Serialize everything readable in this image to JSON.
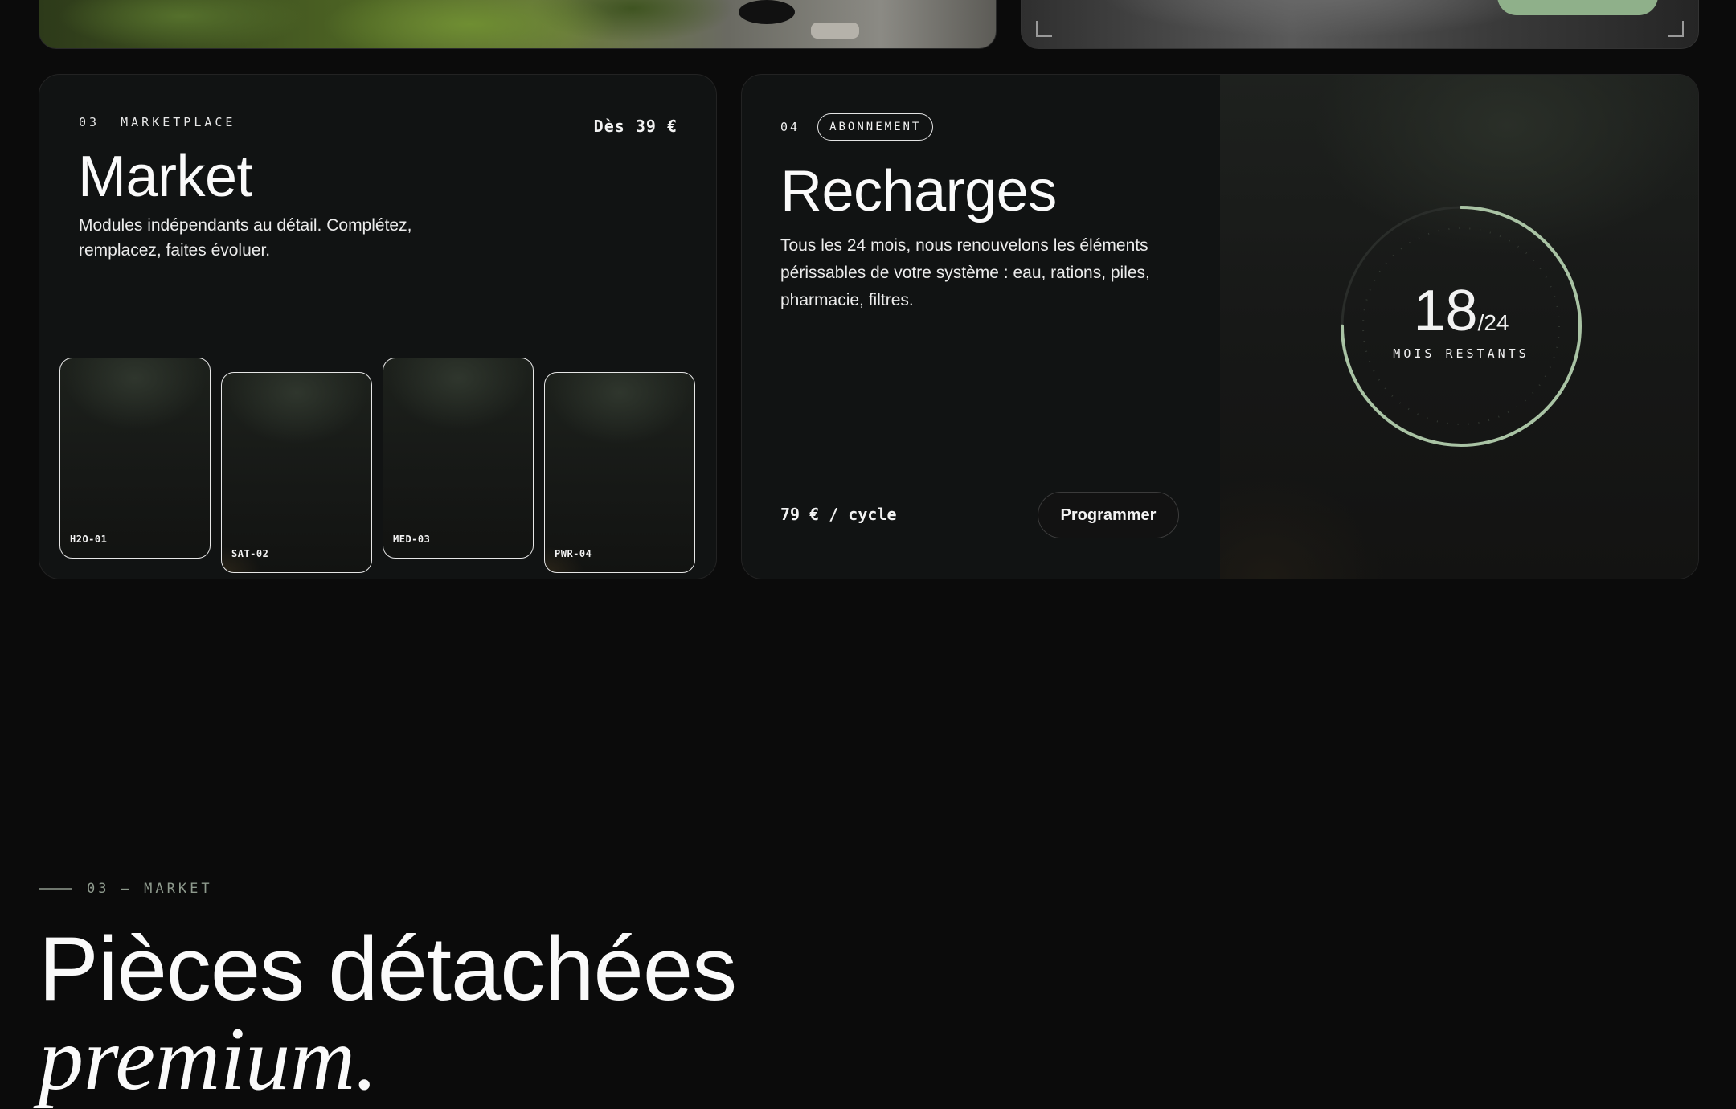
{
  "market_card": {
    "eyebrow": "03  MARKETPLACE",
    "price": "Dès 39 €",
    "title": "Market",
    "description": "Modules indépendants au détail. Complétez, remplacez, faites évoluer.",
    "modules": [
      "H2O-01",
      "SAT-02",
      "MED-03",
      "PWR-04"
    ]
  },
  "recharges_card": {
    "number": "04",
    "badge": "ABONNEMENT",
    "title": "Recharges",
    "description": "Tous les 24 mois, nous renouvelons les éléments périssables de votre système : eau, rations, piles, pharmacie, filtres.",
    "price": "79 € / cycle",
    "button": "Programmer",
    "gauge": {
      "value": "18",
      "total": "/24",
      "label": "MOIS RESTANTS",
      "fraction": 0.75,
      "color": "#a9c3a4"
    }
  },
  "section": {
    "label": "03 — MARKET",
    "title_line1": "Pièces détachées",
    "title_line2": "premium."
  }
}
